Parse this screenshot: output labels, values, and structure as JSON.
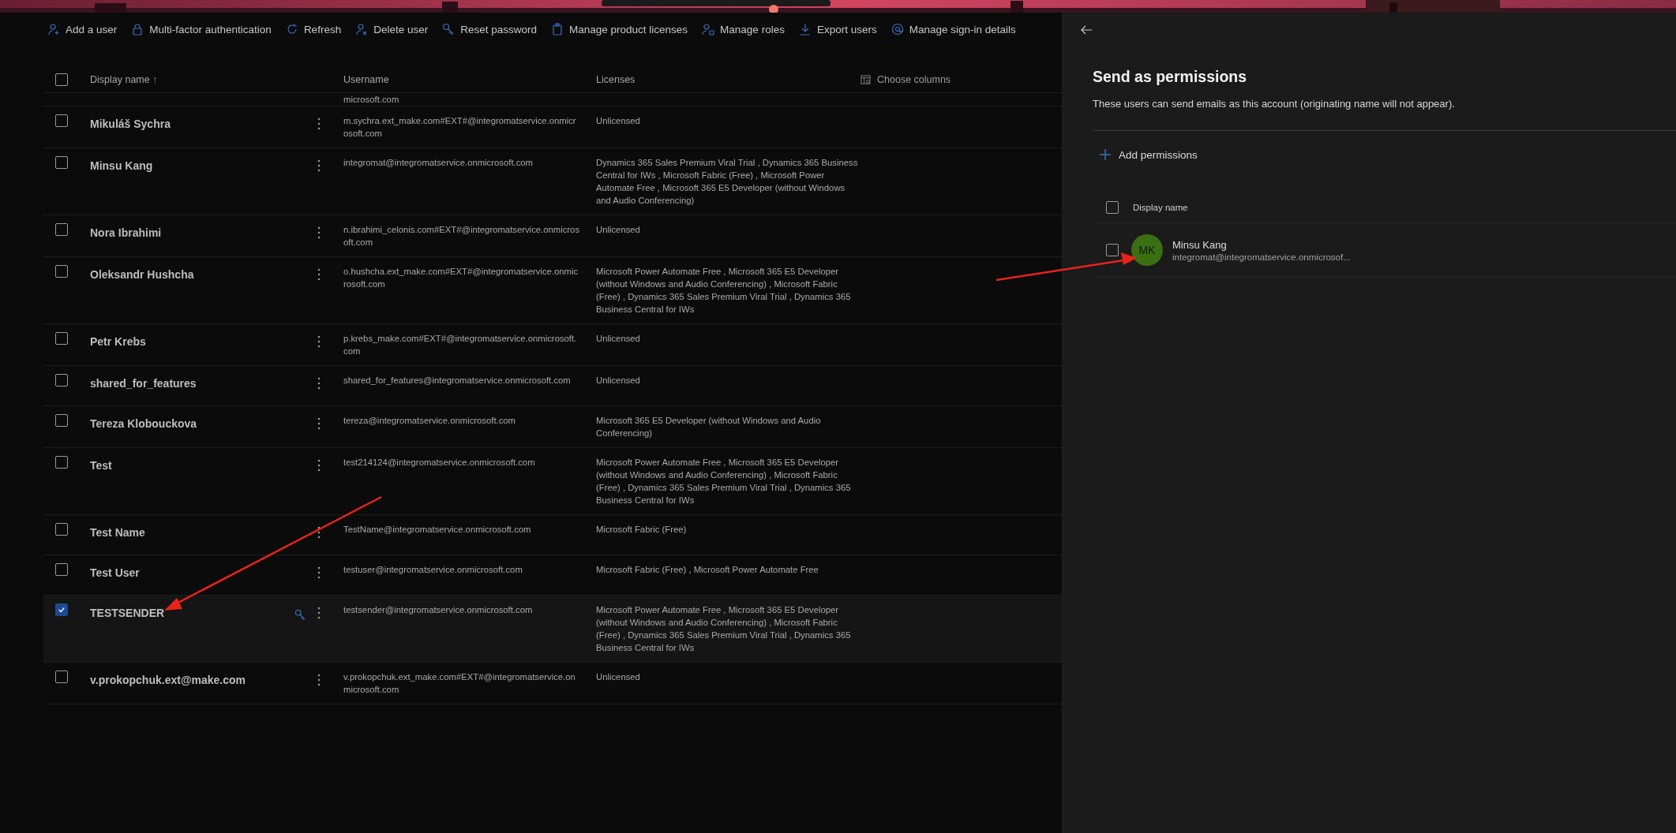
{
  "toolbar": [
    "Add a user",
    "Multi-factor authentication",
    "Refresh",
    "Delete user",
    "Reset password",
    "Manage product licenses",
    "Manage roles",
    "Export users",
    "Manage sign-in details"
  ],
  "table": {
    "all_selected": false,
    "columns": [
      "Display name",
      "Username",
      "Licenses"
    ],
    "sorted_column_arrow": "↑",
    "choose_columns": "Choose columns",
    "partial_row": {
      "username": "microsoft.com"
    },
    "rows": [
      {
        "name": "Mikuláš Sychra",
        "username": "m.sychra.ext_make.com#EXT#@integromatservice.onmicrosoft.com",
        "licenses": "Unlicensed",
        "selected": false
      },
      {
        "name": "Minsu Kang",
        "username": "integromat@integromatservice.onmicrosoft.com",
        "licenses": "Dynamics 365 Sales Premium Viral Trial , Dynamics 365 Business Central for IWs , Microsoft Fabric (Free) , Microsoft Power Automate Free , Microsoft 365 E5 Developer (without Windows and Audio Conferencing)",
        "selected": false
      },
      {
        "name": "Nora Ibrahimi",
        "username": "n.ibrahimi_celonis.com#EXT#@integromatservice.onmicrosoft.com",
        "licenses": "Unlicensed",
        "selected": false
      },
      {
        "name": "Oleksandr Hushcha",
        "username": "o.hushcha.ext_make.com#EXT#@integromatservice.onmicrosoft.com",
        "licenses": "Microsoft Power Automate Free , Microsoft 365 E5 Developer (without Windows and Audio Conferencing) , Microsoft Fabric (Free) , Dynamics 365 Sales Premium Viral Trial , Dynamics 365 Business Central for IWs",
        "selected": false
      },
      {
        "name": "Petr Krebs",
        "username": "p.krebs_make.com#EXT#@integromatservice.onmicrosoft.com",
        "licenses": "Unlicensed",
        "selected": false
      },
      {
        "name": "shared_for_features",
        "username": "shared_for_features@integromatservice.onmicrosoft.com",
        "licenses": "Unlicensed",
        "selected": false
      },
      {
        "name": "Tereza Klobouckova",
        "username": "tereza@integromatservice.onmicrosoft.com",
        "licenses": "Microsoft 365 E5 Developer (without Windows and Audio Conferencing)",
        "selected": false
      },
      {
        "name": "Test",
        "username": "test214124@integromatservice.onmicrosoft.com",
        "licenses": "Microsoft Power Automate Free , Microsoft 365 E5 Developer (without Windows and Audio Conferencing) , Microsoft Fabric (Free) , Dynamics 365 Sales Premium Viral Trial , Dynamics 365 Business Central for IWs",
        "selected": false
      },
      {
        "name": "Test Name",
        "username": "TestName@integromatservice.onmicrosoft.com",
        "licenses": "Microsoft Fabric (Free)",
        "selected": false
      },
      {
        "name": "Test User",
        "username": "testuser@integromatservice.onmicrosoft.com",
        "licenses": "Microsoft Fabric (Free) , Microsoft Power Automate Free",
        "selected": false
      },
      {
        "name": "TESTSENDER",
        "username": "testsender@integromatservice.onmicrosoft.com",
        "licenses": "Microsoft Power Automate Free , Microsoft 365 E5 Developer (without Windows and Audio Conferencing) , Microsoft Fabric (Free) , Dynamics 365 Sales Premium Viral Trial , Dynamics 365 Business Central for IWs",
        "selected": true
      },
      {
        "name": "v.prokopchuk.ext@make.com",
        "username": "v.prokopchuk.ext_make.com#EXT#@integromatservice.onmicrosoft.com",
        "licenses": "Unlicensed",
        "selected": false
      }
    ]
  },
  "panel": {
    "title": "Send as permissions",
    "description": "These users can send emails as this account (originating name will not appear).",
    "add_button": "Add permissions",
    "table": {
      "all_selected": false,
      "column": "Display name",
      "rows": [
        {
          "initials": "MK",
          "name": "Minsu Kang",
          "email": "integromat@integromatservice.onmicrosof...",
          "color": "#3b7012",
          "selected": false
        }
      ]
    }
  }
}
